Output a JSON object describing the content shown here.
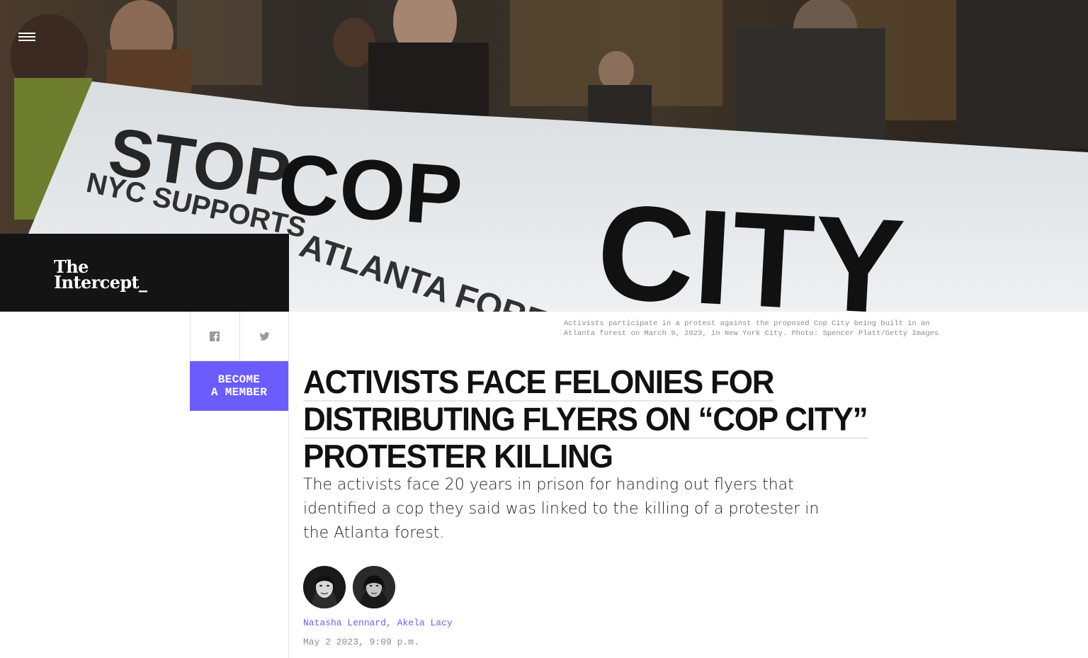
{
  "header": {
    "logo_line1": "The",
    "logo_line2": "Intercept_",
    "menu_icon": "hamburger-menu-icon"
  },
  "hero": {
    "banner_text_main": "STOP COP CITY",
    "banner_text_sub": "NYC SUPPORTS ATLANTA FOREST",
    "caption": "Activists participate in a protest against the proposed Cop City being built in an Atlanta forest on March 9, 2023, in New York City. Photo: Spencer Platt/Getty Images"
  },
  "share": {
    "facebook_icon": "facebook-icon",
    "twitter_icon": "twitter-icon"
  },
  "membership": {
    "line1": "BECOME",
    "line2": "A MEMBER",
    "color": "#6a5cff"
  },
  "article": {
    "headline_line1": "ACTIVISTS FACE FELONIES FOR",
    "headline_line2": "DISTRIBUTING FLYERS ON “COP CITY”",
    "headline_line3": "PROTESTER KILLING",
    "dek": "The activists face 20 years in prison for handing out flyers that identified a cop they said was linked to the killing of a protester in the Atlanta forest.",
    "authors": [
      {
        "name": "Natasha Lennard"
      },
      {
        "name": "Akela Lacy"
      }
    ],
    "author_separator": ",",
    "date": "May 2 2023, 9:09 p.m."
  },
  "colors": {
    "accent": "#6a5cff",
    "logo_bg": "#141414"
  }
}
